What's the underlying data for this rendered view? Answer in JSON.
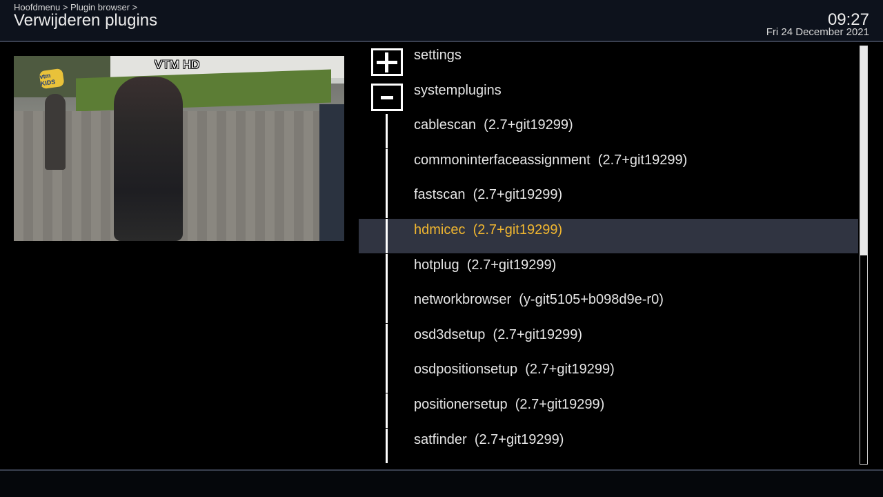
{
  "header": {
    "breadcrumb": "Hoofdmenu > Plugin browser >",
    "title": "Verwijderen plugins",
    "time": "09:27",
    "date": "Fri 24 December 2021"
  },
  "preview": {
    "channel": "VTM HD",
    "logo_text": "vtm KIDS"
  },
  "plugin_list": {
    "items": [
      {
        "label": "settings",
        "type": "category",
        "expander": "plus"
      },
      {
        "label": "systemplugins",
        "type": "category",
        "expander": "minus"
      },
      {
        "label": "cablescan  (2.7+git19299)",
        "type": "plugin"
      },
      {
        "label": "commoninterfaceassignment  (2.7+git19299)",
        "type": "plugin"
      },
      {
        "label": "fastscan  (2.7+git19299)",
        "type": "plugin"
      },
      {
        "label": "hdmicec  (2.7+git19299)",
        "type": "plugin",
        "selected": true
      },
      {
        "label": "hotplug  (2.7+git19299)",
        "type": "plugin"
      },
      {
        "label": "networkbrowser  (y-git5105+b098d9e-r0)",
        "type": "plugin"
      },
      {
        "label": "osd3dsetup  (2.7+git19299)",
        "type": "plugin"
      },
      {
        "label": "osdpositionsetup  (2.7+git19299)",
        "type": "plugin"
      },
      {
        "label": "positionersetup  (2.7+git19299)",
        "type": "plugin"
      },
      {
        "label": "satfinder  (2.7+git19299)",
        "type": "plugin"
      }
    ],
    "selected_color": "#f0b630",
    "selected_background": "#303441"
  },
  "scrollbar": {
    "position_fraction": 0.5
  }
}
